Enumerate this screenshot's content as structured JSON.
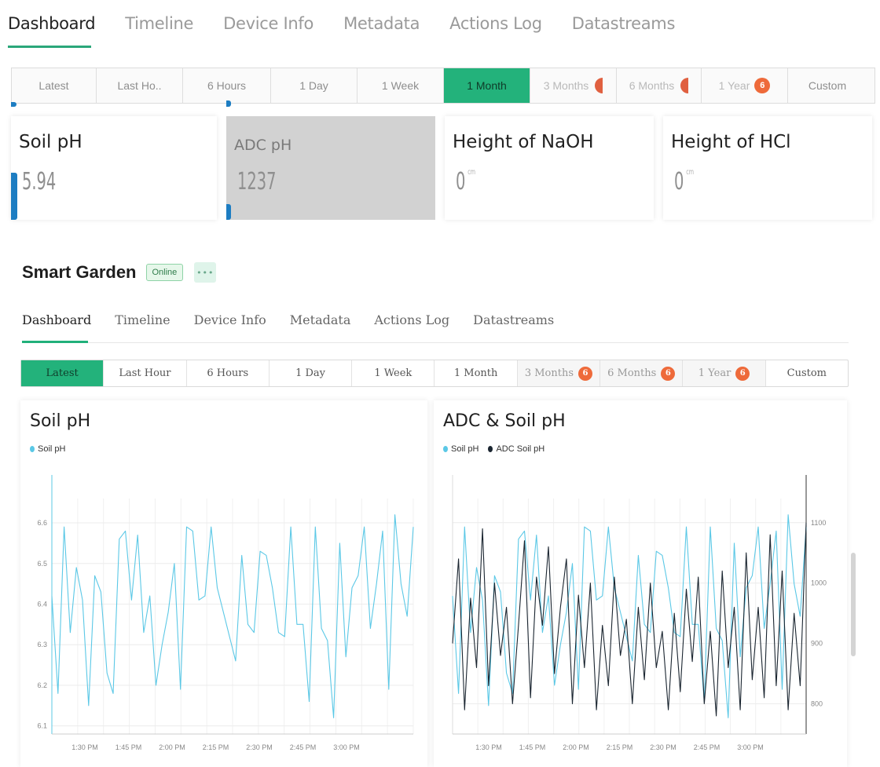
{
  "top": {
    "tabs": [
      "Dashboard",
      "Timeline",
      "Device Info",
      "Metadata",
      "Actions Log",
      "Datastreams"
    ],
    "range": [
      "Latest",
      "Last Ho..",
      "6 Hours",
      "1 Day",
      "1 Week",
      "1 Month",
      "3 Months",
      "6 Months",
      "1 Year",
      "Custom"
    ],
    "active_range": "1 Month",
    "tiles": [
      {
        "title": "Soil pH",
        "value": "5.94",
        "unit": ""
      },
      {
        "title": "ADC pH",
        "value": "1237",
        "unit": ""
      },
      {
        "title": "Height of NaOH",
        "value": "0",
        "unit": "cm"
      },
      {
        "title": "Height of HCl",
        "value": "0",
        "unit": "cm"
      }
    ],
    "lock_badge": "6"
  },
  "device": {
    "title": "Smart Garden",
    "status": "Online",
    "more": "•••"
  },
  "tabs": [
    "Dashboard",
    "Timeline",
    "Device Info",
    "Metadata",
    "Actions Log",
    "Datastreams"
  ],
  "range": {
    "options": [
      "Latest",
      "Last Hour",
      "6 Hours",
      "1 Day",
      "1 Week",
      "1 Month",
      "3 Months",
      "6 Months",
      "1 Year",
      "Custom"
    ],
    "active": "Latest",
    "locked": [
      "3 Months",
      "6 Months",
      "1 Year"
    ],
    "lock_badge": "6"
  },
  "colors": {
    "accent": "#23b27b",
    "soil_ph": "#5bc8e6",
    "adc": "#1a2530",
    "lock": "#ee6a3a"
  },
  "chart_data": [
    {
      "type": "line",
      "title": "Soil pH",
      "legend": [
        "Soil pH"
      ],
      "x_ticks": [
        "1:30 PM",
        "1:45 PM",
        "2:00 PM",
        "2:15 PM",
        "2:30 PM",
        "2:45 PM",
        "3:00 PM"
      ],
      "y_ticks": [
        6.1,
        6.2,
        6.3,
        6.4,
        6.5,
        6.6
      ],
      "ylim": [
        6.08,
        6.66
      ],
      "series": [
        {
          "name": "Soil pH",
          "values": [
            6.42,
            6.18,
            6.59,
            6.33,
            6.49,
            6.41,
            6.15,
            6.47,
            6.43,
            6.23,
            6.18,
            6.56,
            6.58,
            6.41,
            6.57,
            6.33,
            6.42,
            6.2,
            6.3,
            6.38,
            6.5,
            6.19,
            6.59,
            6.58,
            6.41,
            6.42,
            6.59,
            6.44,
            6.38,
            6.32,
            6.26,
            6.52,
            6.35,
            6.33,
            6.53,
            6.52,
            6.44,
            6.33,
            6.32,
            6.59,
            6.35,
            6.35,
            6.16,
            6.59,
            6.34,
            6.31,
            6.12,
            6.55,
            6.27,
            6.44,
            6.47,
            6.59,
            6.34,
            6.45,
            6.58,
            6.19,
            6.62,
            6.45,
            6.37,
            6.59
          ]
        }
      ]
    },
    {
      "type": "line",
      "title": "ADC & Soil pH",
      "legend": [
        "Soil pH",
        "ADC Soil pH"
      ],
      "x_ticks": [
        "1:30 PM",
        "1:45 PM",
        "2:00 PM",
        "2:15 PM",
        "2:30 PM",
        "2:45 PM",
        "3:00 PM"
      ],
      "y2_ticks": [
        800,
        900,
        1000,
        1100
      ],
      "y2lim": [
        750,
        1140
      ],
      "series": [
        {
          "name": "Soil pH",
          "values": [
            6.42,
            6.18,
            6.59,
            6.33,
            6.49,
            6.41,
            6.15,
            6.47,
            6.43,
            6.23,
            6.18,
            6.56,
            6.58,
            6.41,
            6.57,
            6.33,
            6.42,
            6.2,
            6.3,
            6.38,
            6.5,
            6.19,
            6.59,
            6.58,
            6.41,
            6.42,
            6.59,
            6.44,
            6.38,
            6.32,
            6.26,
            6.52,
            6.35,
            6.33,
            6.53,
            6.52,
            6.44,
            6.33,
            6.32,
            6.59,
            6.35,
            6.35,
            6.16,
            6.59,
            6.34,
            6.31,
            6.12,
            6.55,
            6.27,
            6.44,
            6.47,
            6.59,
            6.34,
            6.45,
            6.58,
            6.19,
            6.62,
            6.45,
            6.37,
            6.59
          ]
        },
        {
          "name": "ADC Soil pH",
          "values": [
            900,
            1040,
            790,
            975,
            860,
            1090,
            830,
            1000,
            880,
            960,
            800,
            930,
            1070,
            810,
            1010,
            930,
            1060,
            850,
            960,
            1040,
            800,
            980,
            860,
            1000,
            790,
            930,
            830,
            1010,
            880,
            940,
            800,
            960,
            840,
            1000,
            860,
            920,
            790,
            950,
            820,
            990,
            870,
            1010,
            800,
            920,
            780,
            1020,
            860,
            960,
            790,
            1050,
            840,
            960,
            810,
            1080,
            830,
            1020,
            790,
            950,
            830,
            1100
          ]
        }
      ]
    }
  ]
}
